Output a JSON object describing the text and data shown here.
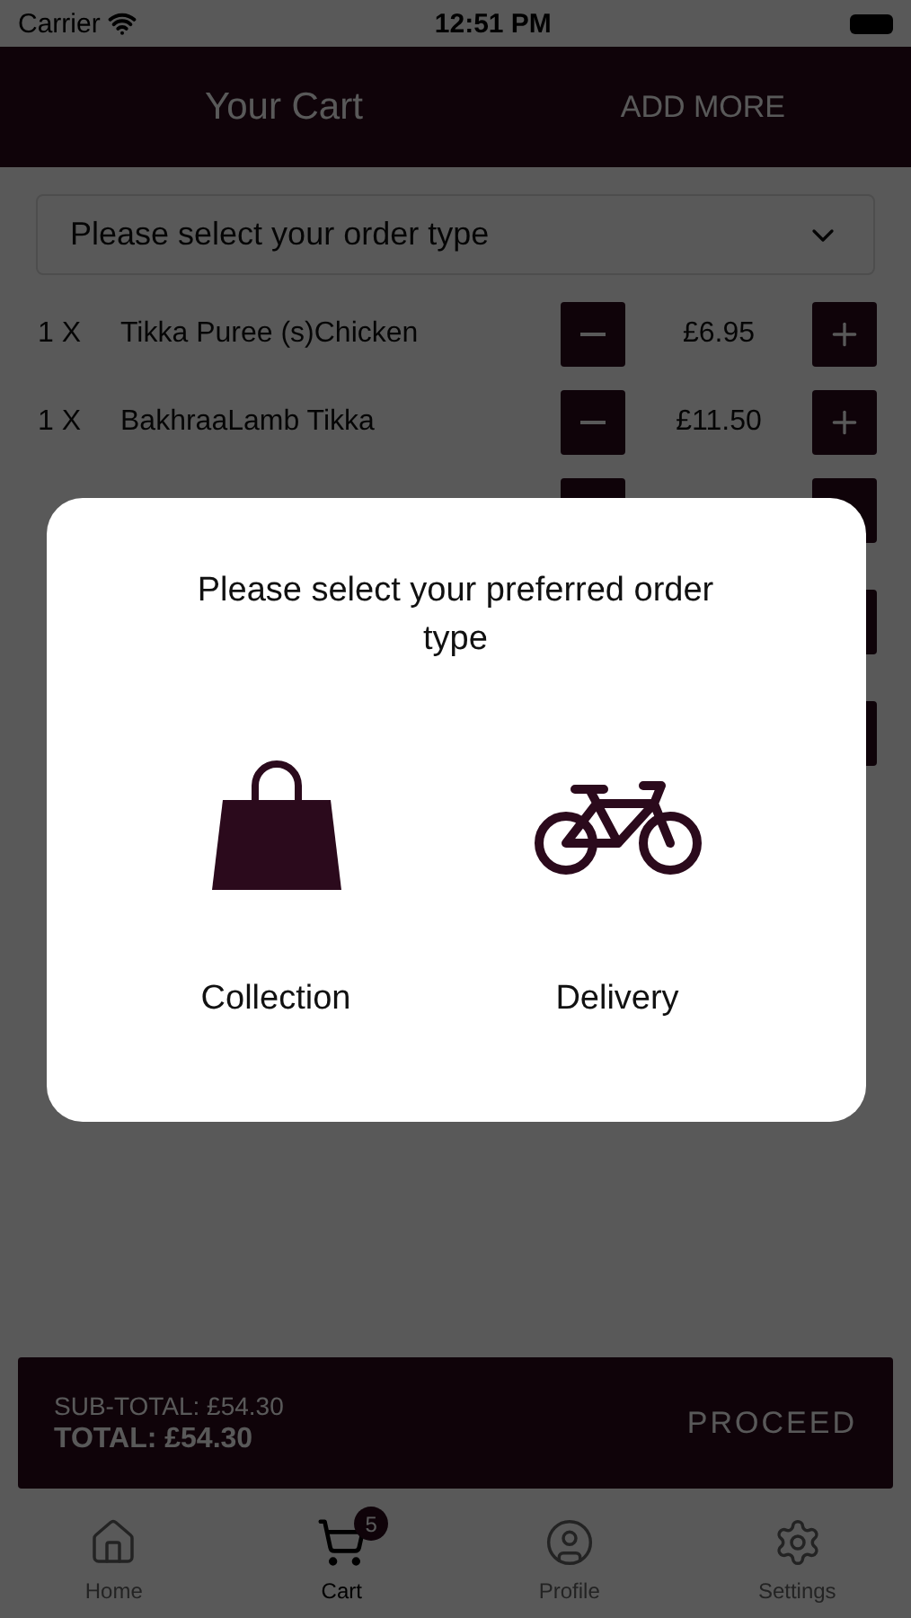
{
  "status_bar": {
    "carrier": "Carrier",
    "time": "12:51 PM"
  },
  "header": {
    "title": "Your Cart",
    "action": "ADD MORE"
  },
  "order_type_select": {
    "placeholder": "Please select your order type"
  },
  "cart_items": [
    {
      "kind": "full",
      "quantity": "1 X",
      "name": "Tikka Puree (s)Chicken",
      "price": "£6.95"
    },
    {
      "kind": "full",
      "quantity": "1 X",
      "name": "BakhraaLamb Tikka",
      "price": "£11.50"
    },
    {
      "kind": "hidden"
    },
    {
      "kind": "hidden"
    },
    {
      "kind": "hidden"
    }
  ],
  "totals": {
    "subtotal": "SUB-TOTAL: £54.30",
    "total": "TOTAL: £54.30",
    "proceed": "PROCEED"
  },
  "tab_bar": [
    {
      "kind": "home",
      "label": "Home",
      "selected": false
    },
    {
      "kind": "cart",
      "label": "Cart",
      "selected": true,
      "badge": "5"
    },
    {
      "kind": "profile",
      "label": "Profile",
      "selected": false
    },
    {
      "kind": "settings",
      "label": "Settings",
      "selected": false
    }
  ],
  "modal": {
    "title": "Please select your preferred order type",
    "options": [
      {
        "kind": "collection",
        "label": "Collection"
      },
      {
        "kind": "delivery",
        "label": "Delivery"
      }
    ]
  }
}
